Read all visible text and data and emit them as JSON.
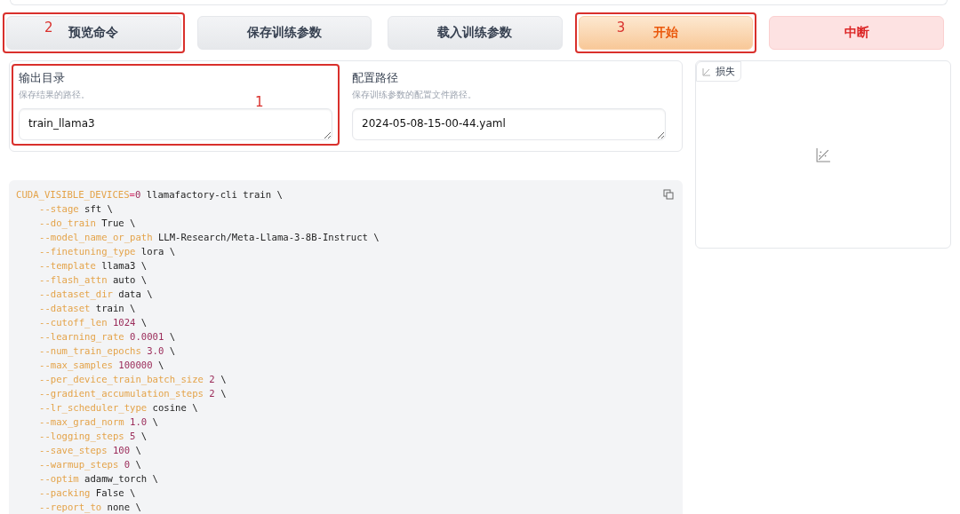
{
  "buttons": [
    {
      "label": "预览命令",
      "kind": "secondary",
      "annotation": "2"
    },
    {
      "label": "保存训练参数",
      "kind": "secondary"
    },
    {
      "label": "载入训练参数",
      "kind": "secondary"
    },
    {
      "label": "开始",
      "kind": "primary",
      "annotation": "3"
    },
    {
      "label": "中断",
      "kind": "stop"
    }
  ],
  "fields": [
    {
      "label": "输出目录",
      "info": "保存结果的路径。",
      "value": "train_llama3",
      "annotation": "1"
    },
    {
      "label": "配置路径",
      "info": "保存训练参数的配置文件路径。",
      "value": "2024-05-08-15-00-44.yaml"
    }
  ],
  "command": {
    "first_line": [
      {
        "text": "CUDA_VISIBLE_DEVICES",
        "kind": "key"
      },
      {
        "text": "=",
        "kind": "op"
      },
      {
        "text": "0",
        "kind": "num"
      },
      {
        "text": " llamafactory-cli train \\",
        "kind": "plain"
      }
    ],
    "lines": [
      {
        "flag": "--stage",
        "value": "sft",
        "kind": "plain",
        "cont": "\\"
      },
      {
        "flag": "--do_train",
        "value": "True",
        "kind": "plain",
        "cont": "\\"
      },
      {
        "flag": "--model_name_or_path",
        "value": "LLM-Research/Meta-Llama-3-8B-Instruct",
        "kind": "plain",
        "cont": "\\"
      },
      {
        "flag": "--finetuning_type",
        "value": "lora",
        "kind": "plain",
        "cont": "\\"
      },
      {
        "flag": "--template",
        "value": "llama3",
        "kind": "plain",
        "cont": "\\"
      },
      {
        "flag": "--flash_attn",
        "value": "auto",
        "kind": "plain",
        "cont": "\\"
      },
      {
        "flag": "--dataset_dir",
        "value": "data",
        "kind": "plain",
        "cont": "\\"
      },
      {
        "flag": "--dataset",
        "value": "train",
        "kind": "plain",
        "cont": "\\"
      },
      {
        "flag": "--cutoff_len",
        "value": "1024",
        "kind": "num",
        "cont": "\\"
      },
      {
        "flag": "--learning_rate",
        "value": "0.0001",
        "kind": "num",
        "cont": "\\"
      },
      {
        "flag": "--num_train_epochs",
        "value": "3.0",
        "kind": "num",
        "cont": "\\"
      },
      {
        "flag": "--max_samples",
        "value": "100000",
        "kind": "num",
        "cont": "\\"
      },
      {
        "flag": "--per_device_train_batch_size",
        "value": "2",
        "kind": "num",
        "cont": "\\"
      },
      {
        "flag": "--gradient_accumulation_steps",
        "value": "2",
        "kind": "num",
        "cont": "\\"
      },
      {
        "flag": "--lr_scheduler_type",
        "value": "cosine",
        "kind": "plain",
        "cont": "\\"
      },
      {
        "flag": "--max_grad_norm",
        "value": "1.0",
        "kind": "num",
        "cont": "\\"
      },
      {
        "flag": "--logging_steps",
        "value": "5",
        "kind": "num",
        "cont": "\\"
      },
      {
        "flag": "--save_steps",
        "value": "100",
        "kind": "num",
        "cont": "\\"
      },
      {
        "flag": "--warmup_steps",
        "value": "0",
        "kind": "num",
        "cont": "\\"
      },
      {
        "flag": "--optim",
        "value": "adamw_torch",
        "kind": "plain",
        "cont": "\\"
      },
      {
        "flag": "--packing",
        "value": "False",
        "kind": "plain",
        "cont": "\\"
      },
      {
        "flag": "--report_to",
        "value": "none",
        "kind": "plain",
        "cont": "\\"
      }
    ]
  },
  "loss_panel": {
    "label": "损失"
  }
}
